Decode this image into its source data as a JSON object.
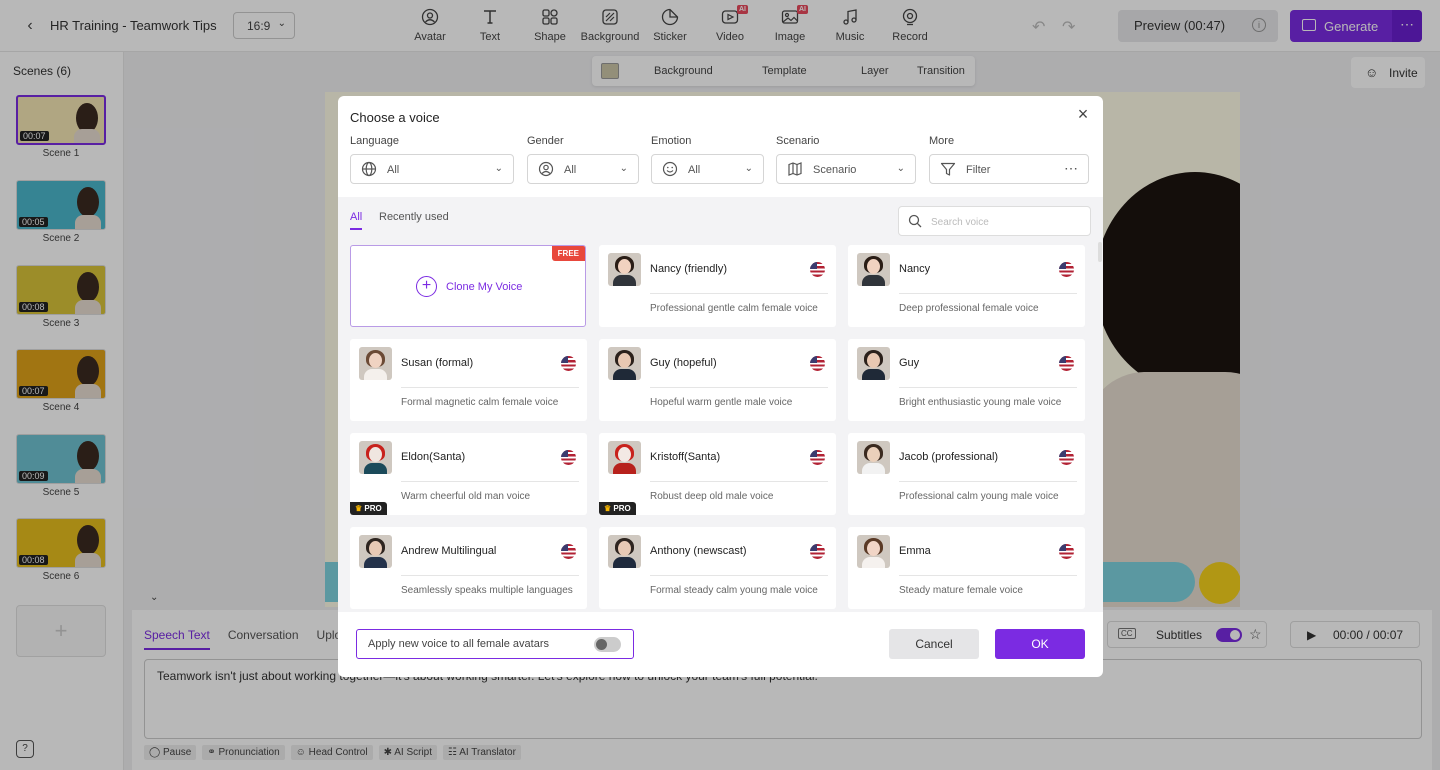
{
  "topbar": {
    "project_title": "HR Training - Teamwork Tips",
    "aspect_ratio": "16:9",
    "tools": [
      {
        "label": "Avatar",
        "icon": "avatar-icon",
        "ai": false
      },
      {
        "label": "Text",
        "icon": "text-icon",
        "ai": false
      },
      {
        "label": "Shape",
        "icon": "shape-icon",
        "ai": false
      },
      {
        "label": "Background",
        "icon": "background-icon",
        "ai": false
      },
      {
        "label": "Sticker",
        "icon": "sticker-icon",
        "ai": false
      },
      {
        "label": "Video",
        "icon": "video-icon",
        "ai": true
      },
      {
        "label": "Image",
        "icon": "image-icon",
        "ai": true
      },
      {
        "label": "Music",
        "icon": "music-icon",
        "ai": false
      },
      {
        "label": "Record",
        "icon": "record-icon",
        "ai": false
      }
    ],
    "ai_badge": "AI",
    "preview_label": "Preview (00:47)",
    "generate_label": "Generate",
    "accent_color": "#7b2be2"
  },
  "sidebar": {
    "title": "Scenes (6)",
    "scenes": [
      {
        "label": "Scene 1",
        "time": "00:07",
        "bg": "#f4e7b5"
      },
      {
        "label": "Scene 2",
        "time": "00:05",
        "bg": "#4cb7cc"
      },
      {
        "label": "Scene 3",
        "time": "00:08",
        "bg": "#d8c43a"
      },
      {
        "label": "Scene 4",
        "time": "00:07",
        "bg": "#e0a21a"
      },
      {
        "label": "Scene 5",
        "time": "00:09",
        "bg": "#6fc3d2"
      },
      {
        "label": "Scene 6",
        "time": "00:08",
        "bg": "#e6be1e"
      }
    ]
  },
  "canvas_toolbar": {
    "background": "Background",
    "template": "Template",
    "layer": "Layer",
    "transition": "Transition"
  },
  "invite_label": "Invite",
  "bottom_panel": {
    "tabs": [
      "Speech Text",
      "Conversation",
      "Uploa"
    ],
    "subtitles_label": "Subtitles",
    "time_display": "00:00 / 00:07",
    "speech_text": "Teamwork isn't just about working together—it's about working smarter. Let's explore how to unlock your team's full potential.",
    "actions": [
      "Pause",
      "Pronunciation",
      "Head Control",
      "AI Script",
      "AI Translator"
    ]
  },
  "modal": {
    "title": "Choose a voice",
    "filters": {
      "language": {
        "label": "Language",
        "value": "All"
      },
      "gender": {
        "label": "Gender",
        "value": "All"
      },
      "emotion": {
        "label": "Emotion",
        "value": "All"
      },
      "scenario": {
        "label": "Scenario",
        "value": "Scenario"
      },
      "more": {
        "label": "More",
        "value": "Filter"
      }
    },
    "tabs": {
      "all": "All",
      "recent": "Recently used"
    },
    "search_placeholder": "Search voice",
    "clone": {
      "label": "Clone My Voice",
      "badge": "FREE"
    },
    "pro_badge": "PRO",
    "voices": [
      {
        "name": "Nancy (friendly)",
        "desc": "Professional gentle calm female voice",
        "pro": false,
        "skin": "#f1d2c0",
        "hair": "#2a1d16",
        "shirt": "#30343a"
      },
      {
        "name": "Nancy",
        "desc": "Deep professional female voice",
        "pro": false,
        "skin": "#f1d2c0",
        "hair": "#2a1d16",
        "shirt": "#30343a"
      },
      {
        "name": "Susan (formal)",
        "desc": "Formal magnetic calm female voice",
        "pro": false,
        "skin": "#f0d3c2",
        "hair": "#6b4a35",
        "shirt": "#f4f0ec"
      },
      {
        "name": "Guy (hopeful)",
        "desc": "Hopeful warm gentle male voice",
        "pro": false,
        "skin": "#e9c8b2",
        "hair": "#2b211b",
        "shirt": "#1f2937"
      },
      {
        "name": "Guy",
        "desc": "Bright enthusiastic young male voice",
        "pro": false,
        "skin": "#e9c8b2",
        "hair": "#2b211b",
        "shirt": "#1f2937"
      },
      {
        "name": "Eldon(Santa)",
        "desc": "Warm cheerful old man voice",
        "pro": true,
        "skin": "#f0e6e0",
        "hair": "#c8221c",
        "shirt": "#1b4a5a"
      },
      {
        "name": "Kristoff(Santa)",
        "desc": "Robust deep old male voice",
        "pro": true,
        "skin": "#f3e9e4",
        "hair": "#c8221c",
        "shirt": "#b7211c"
      },
      {
        "name": "Jacob (professional)",
        "desc": "Professional calm young male voice",
        "pro": false,
        "skin": "#ead0bb",
        "hair": "#3a2a20",
        "shirt": "#f2f2f2"
      },
      {
        "name": "Andrew Multilingual",
        "desc": "Seamlessly speaks multiple languages",
        "pro": false,
        "skin": "#e7c9b5",
        "hair": "#2e2520",
        "shirt": "#24324a"
      },
      {
        "name": "Anthony (newscast)",
        "desc": "Formal steady calm young male voice",
        "pro": false,
        "skin": "#e7c9b5",
        "hair": "#2e2520",
        "shirt": "#1f2a3d"
      },
      {
        "name": "Emma",
        "desc": "Steady mature female voice",
        "pro": false,
        "skin": "#f1d5c6",
        "hair": "#5a3a26",
        "shirt": "#f5f1ee"
      }
    ],
    "apply_label": "Apply new voice to all female avatars",
    "cancel_label": "Cancel",
    "ok_label": "OK"
  }
}
